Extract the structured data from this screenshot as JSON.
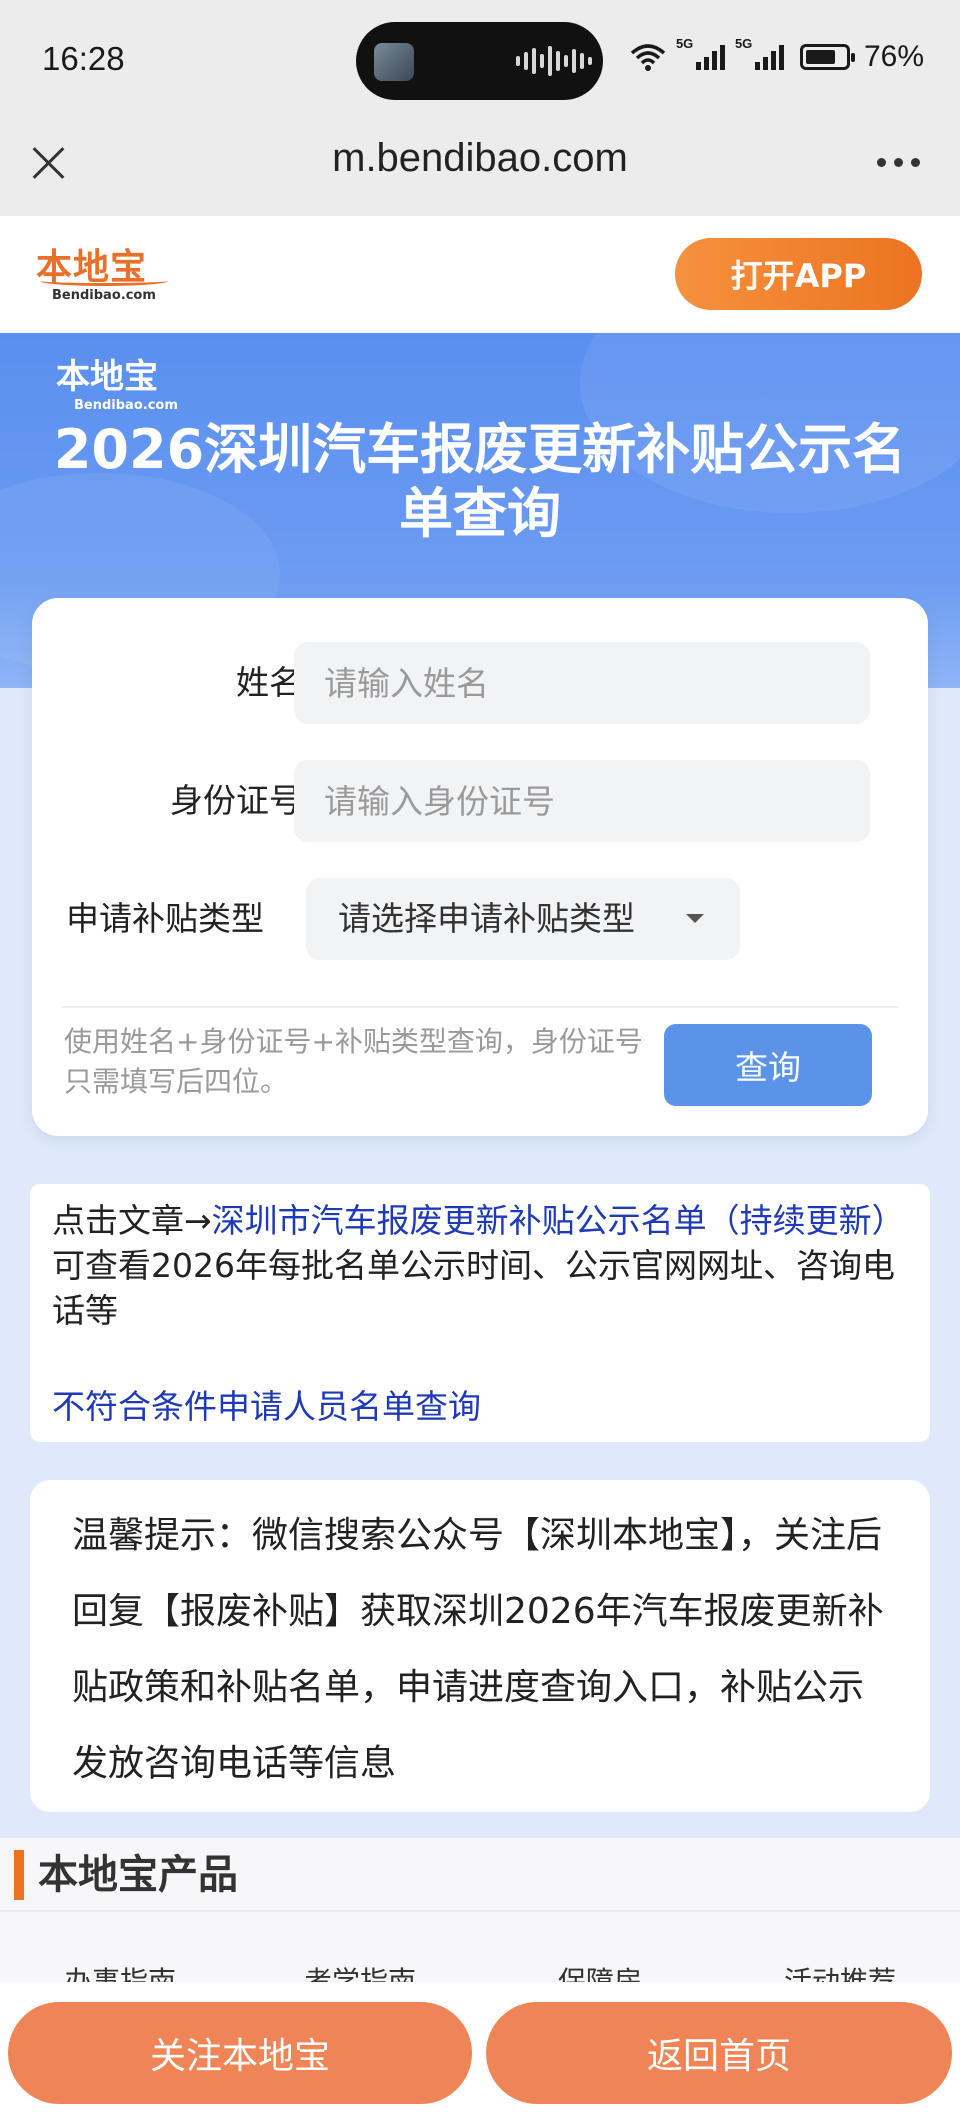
{
  "status_bar": {
    "time": "16:28",
    "signal1_label": "5G",
    "signal2_label": "5G",
    "battery": "76%",
    "battery_level": 0.76
  },
  "browser": {
    "url": "m.bendibao.com",
    "close_icon": "close-icon",
    "more_icon": "more-dots-icon"
  },
  "site_header": {
    "logo_cn": "本地宝",
    "logo_en": "Bendibao.com",
    "open_app": "打开APP"
  },
  "hero": {
    "logo_cn": "本地宝",
    "logo_en": "Bendibao.com",
    "title": "2026深圳汽车报废更新补贴公示名单查询"
  },
  "form": {
    "name_label": "姓名",
    "name_placeholder": "请输入姓名",
    "id_label": "身份证号",
    "id_placeholder": "请输入身份证号",
    "type_label": "申请补贴类型",
    "type_selected": "请选择申请补贴类型",
    "hint": "使用姓名+身份证号+补贴类型查询，身份证号只需填写后四位。",
    "query_button": "查询"
  },
  "info": {
    "prefix": "点击文章→",
    "article_link": "深圳市汽车报废更新补贴公示名单（持续更新）",
    "suffix": "可查看2026年每批名单公示时间、公示官网网址、咨询电话等",
    "ineligible_link": "不符合条件申请人员名单查询"
  },
  "tip": {
    "text": "温馨提示：微信搜索公众号【深圳本地宝】，关注后回复【报废补贴】获取深圳2026年汽车报废更新补贴政策和补贴名单，申请进度查询入口，补贴公示发放咨询电话等信息"
  },
  "products": {
    "title": "本地宝产品",
    "items": [
      "办事指南",
      "考学指南",
      "保障房",
      "活动推荐"
    ]
  },
  "bottom_bar": {
    "follow": "关注本地宝",
    "home": "返回首页"
  }
}
